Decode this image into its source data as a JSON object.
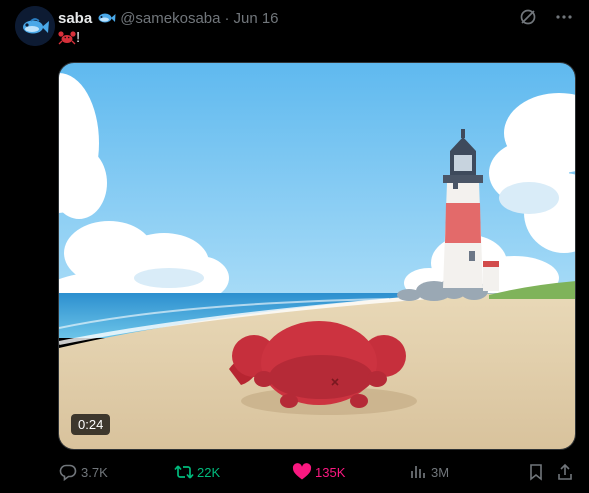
{
  "author": {
    "display_name": "saba",
    "handle": "@samekosaba",
    "separator": "·",
    "date": "Jun 16",
    "badge_icon": "fish-icon",
    "avatar_icon": "fish-avatar"
  },
  "tweet": {
    "emoji_icon": "crab-emoji",
    "text": "!"
  },
  "media": {
    "type": "video",
    "duration": "0:24"
  },
  "toolbar": {
    "grok_icon": "grok-icon",
    "more_icon": "more-icon"
  },
  "actions": {
    "reply_count": "3.7K",
    "repost_count": "22K",
    "like_count": "135K",
    "views_count": "3M"
  },
  "colors": {
    "background": "#000000",
    "text_primary": "#e7e9ea",
    "text_secondary": "#71767b",
    "repost_active": "#00ba7c",
    "like_active": "#f91880"
  }
}
